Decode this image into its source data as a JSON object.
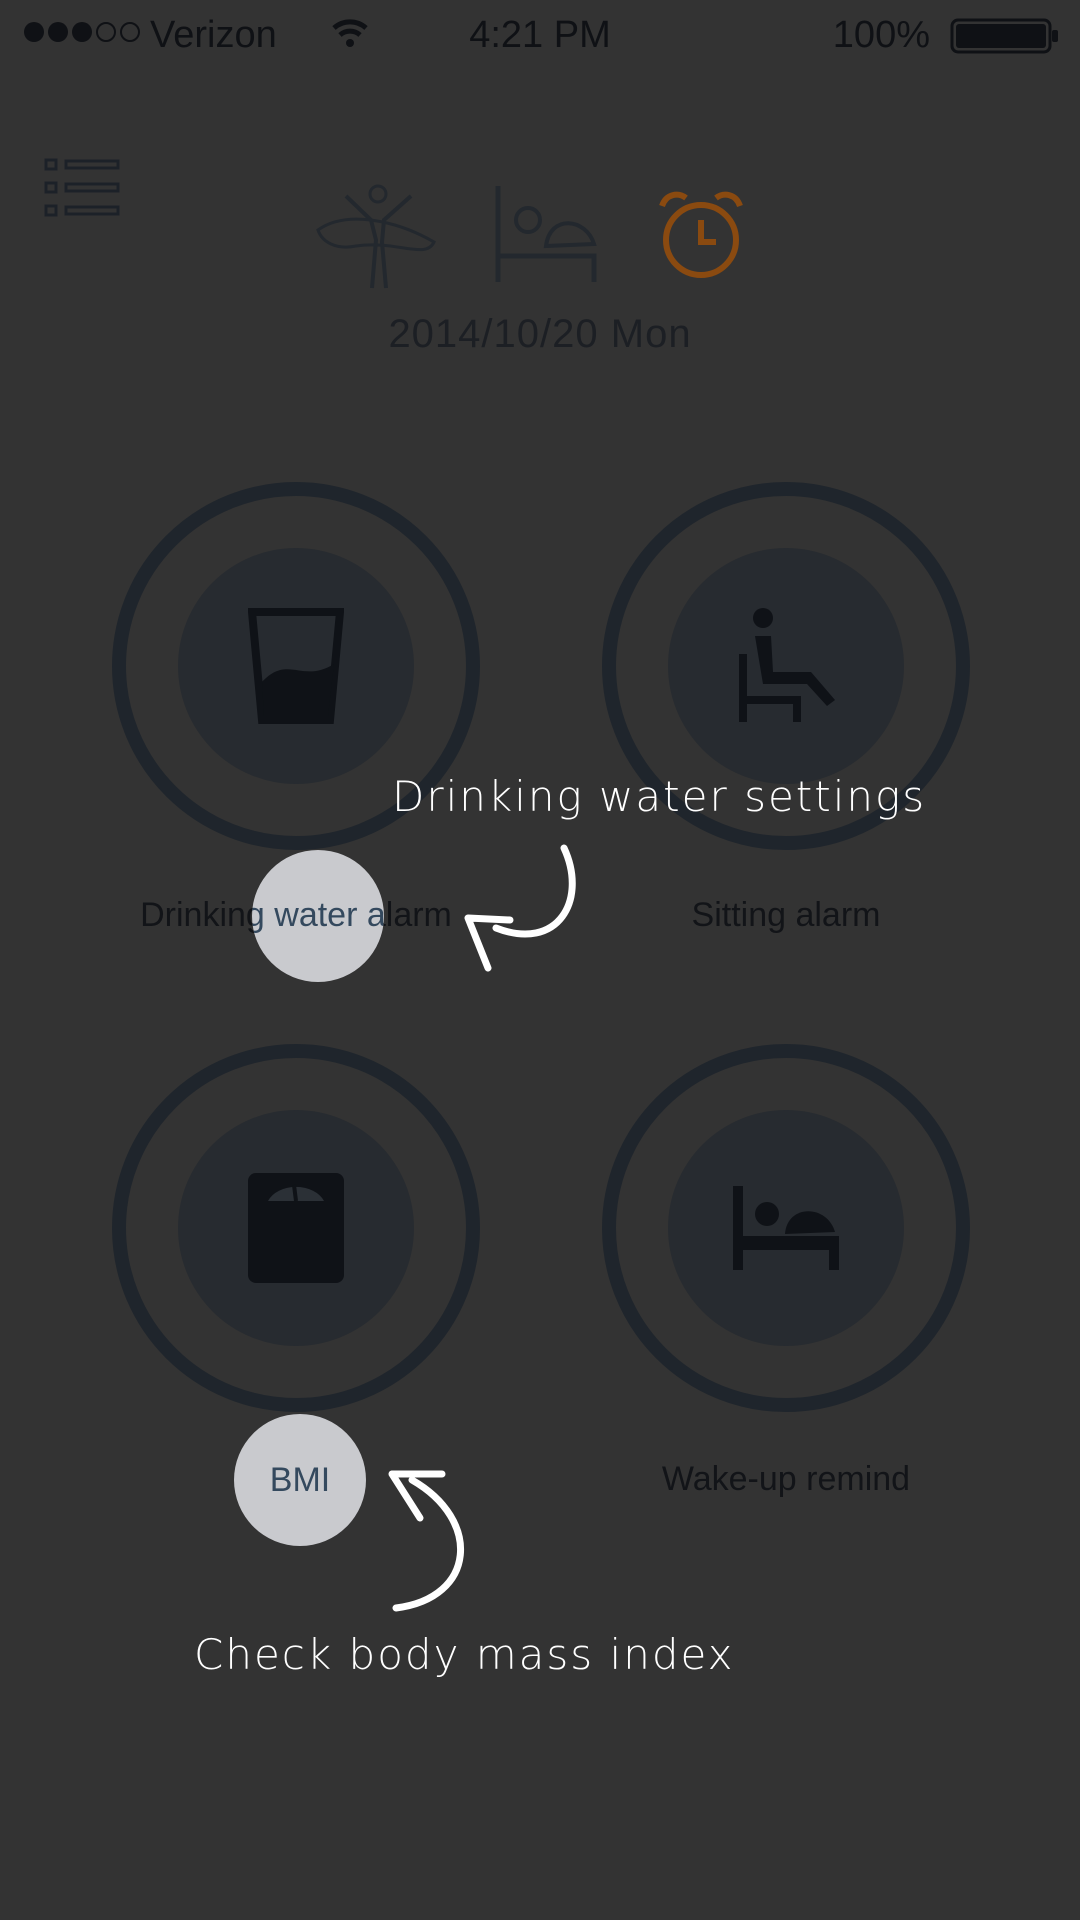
{
  "status_bar": {
    "carrier": "Verizon",
    "time": "4:21 PM",
    "battery": "100%"
  },
  "header": {
    "date": "2014/10/20 Mon",
    "icons": [
      "menu-icon",
      "exercise-icon",
      "sleep-icon",
      "alarm-clock-icon"
    ],
    "active_color": "#8a4a10"
  },
  "tiles": [
    {
      "label": "Drinking water alarm",
      "icon": "water-glass-icon"
    },
    {
      "label": "Sitting alarm",
      "icon": "sitting-icon"
    },
    {
      "label": "BMI",
      "icon": "scale-icon"
    },
    {
      "label": "Wake-up remind",
      "icon": "bed-icon"
    }
  ],
  "tutorial": {
    "water_hint": "Drinking water settings",
    "bmi_hint": "Check body mass index"
  }
}
